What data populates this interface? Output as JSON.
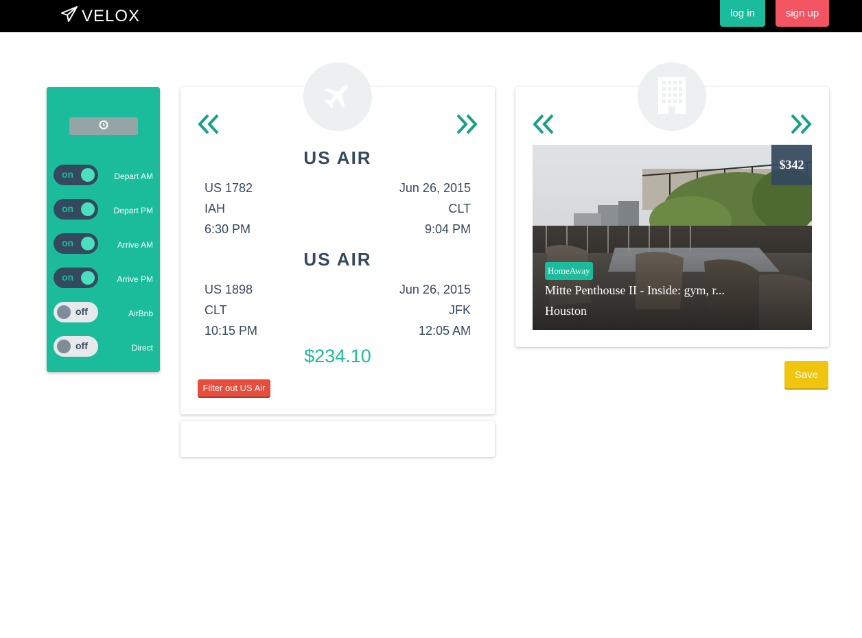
{
  "header": {
    "brand": "VELOX",
    "login_label": "log in",
    "signup_label": "sign up"
  },
  "sidebar": {
    "sort": {
      "time_icon": "clock-icon",
      "price_label": "$"
    },
    "filters": [
      {
        "label": "Depart AM",
        "state": "on"
      },
      {
        "label": "Depart PM",
        "state": "on"
      },
      {
        "label": "Arrive AM",
        "state": "on"
      },
      {
        "label": "Arrive PM",
        "state": "on"
      },
      {
        "label": "AirBnb",
        "state": "off"
      },
      {
        "label": "Direct",
        "state": "off"
      }
    ]
  },
  "flight": {
    "icon": "airplane-icon",
    "legs": [
      {
        "airline": "US AIR",
        "flight_number": "US 1782",
        "date": "Jun 26, 2015",
        "origin": "IAH",
        "destination": "CLT",
        "depart_time": "6:30 PM",
        "arrive_time": "9:04 PM"
      },
      {
        "airline": "US AIR",
        "flight_number": "US 1898",
        "date": "Jun 26, 2015",
        "origin": "CLT",
        "destination": "JFK",
        "depart_time": "10:15 PM",
        "arrive_time": "12:05 AM"
      }
    ],
    "price": "$234.10",
    "filter_button_label": "Filter out US Air"
  },
  "hotel": {
    "icon": "building-icon",
    "price": "$342",
    "source": "HomeAway",
    "name": "Mitte Penthouse II - Inside: gym, r...",
    "city": "Houston"
  },
  "save_label": "Save",
  "colors": {
    "accent": "#1abc9c",
    "dark": "#34495e",
    "danger": "#e74c3c",
    "signup": "#f25462",
    "save": "#f1c40f"
  }
}
